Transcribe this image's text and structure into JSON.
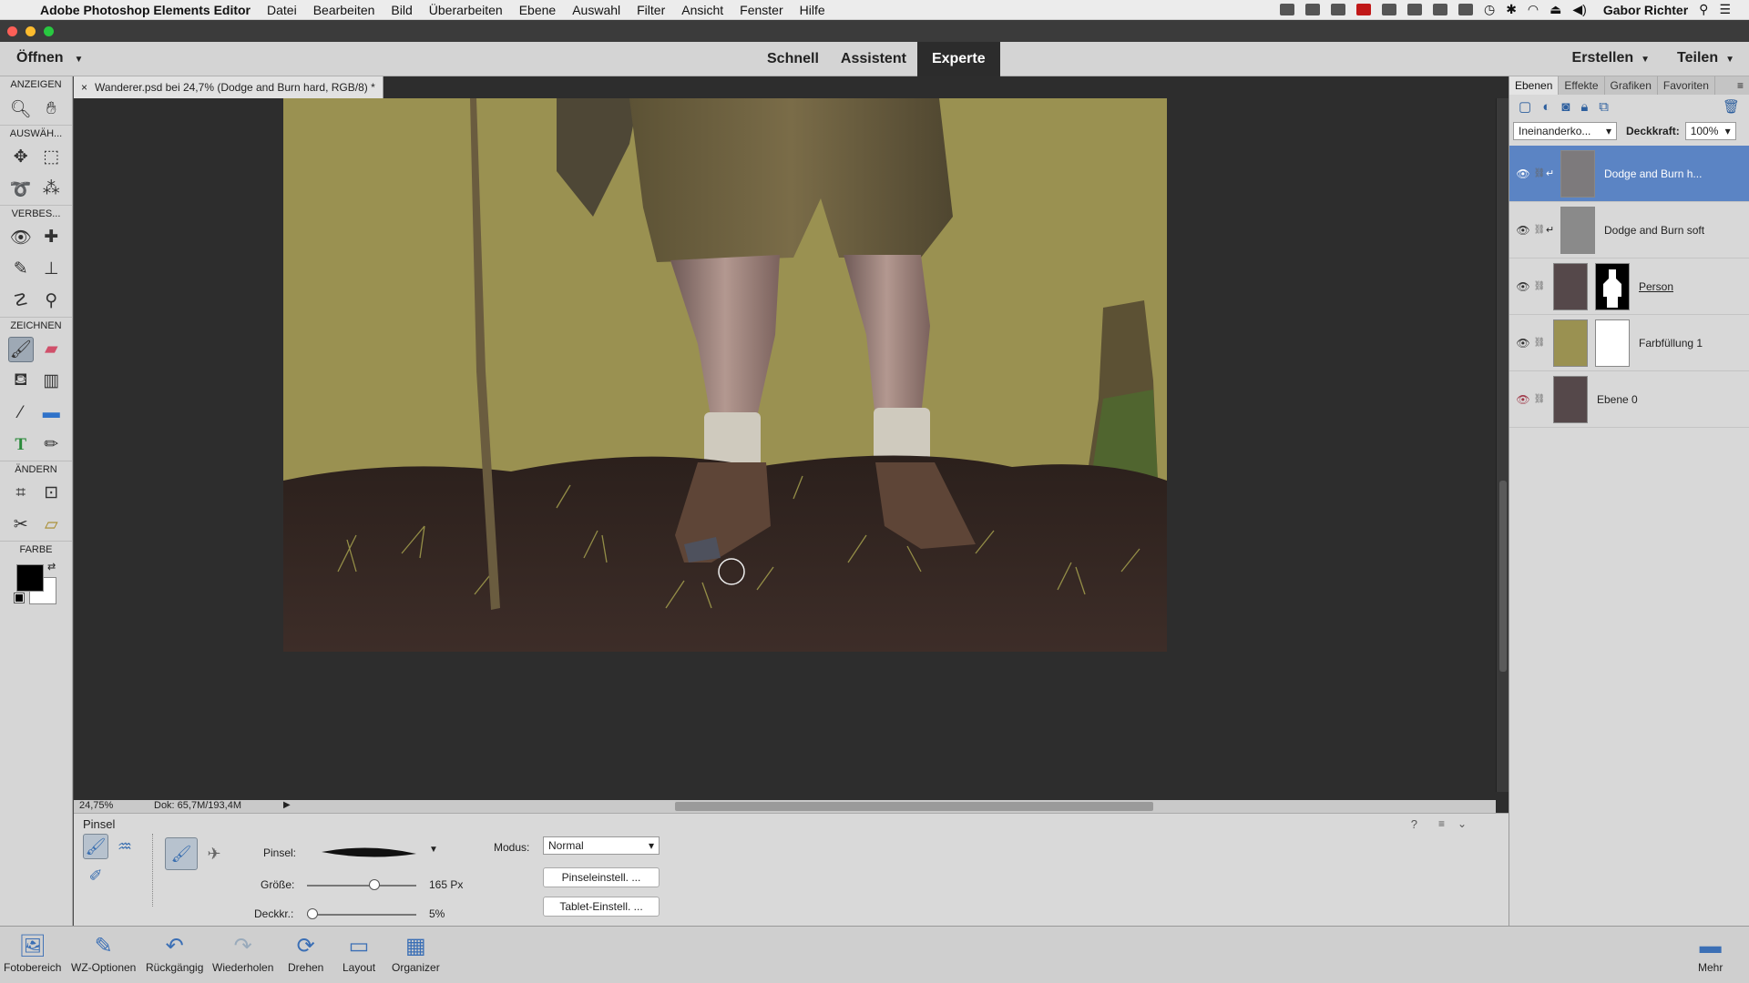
{
  "menubar": {
    "app_name": "Adobe Photoshop Elements Editor",
    "items": [
      "Datei",
      "Bearbeiten",
      "Bild",
      "Überarbeiten",
      "Ebene",
      "Auswahl",
      "Filter",
      "Ansicht",
      "Fenster",
      "Hilfe"
    ],
    "user": "Gabor Richter"
  },
  "modebar": {
    "open_label": "Öffnen",
    "modes": [
      "Schnell",
      "Assistent",
      "Experte"
    ],
    "active_mode": "Experte",
    "create_label": "Erstellen",
    "share_label": "Teilen"
  },
  "toolbox": {
    "sections": [
      "ANZEIGEN",
      "AUSWÄH...",
      "VERBES...",
      "ZEICHNEN",
      "ÄNDERN",
      "FARBE"
    ]
  },
  "document": {
    "tab_title": "Wanderer.psd bei 24,7% (Dodge and Burn hard, RGB/8) *",
    "zoom": "24,75%",
    "doc_info": "Dok: 65,7M/193,4M"
  },
  "layers_panel": {
    "tabs": [
      "Ebenen",
      "Effekte",
      "Grafiken",
      "Favoriten"
    ],
    "active_tab": "Ebenen",
    "blend_mode": "Ineinanderko...",
    "opacity_label": "Deckkraft:",
    "opacity_value": "100%",
    "layers": [
      {
        "name": "Dodge and Burn h...",
        "visible": true,
        "selected": true
      },
      {
        "name": "Dodge and Burn soft",
        "visible": true,
        "selected": false
      },
      {
        "name": "Person",
        "visible": true,
        "selected": false
      },
      {
        "name": "Farbfüllung 1",
        "visible": true,
        "selected": false
      },
      {
        "name": "Ebene 0",
        "visible": false,
        "selected": false
      }
    ]
  },
  "tool_options": {
    "title": "Pinsel",
    "brush_label": "Pinsel:",
    "size_label": "Größe:",
    "size_value": "165 Px",
    "size_fraction": 0.62,
    "opacity_label": "Deckkr.:",
    "opacity_value": "5%",
    "opacity_fraction": 0.05,
    "mode_label": "Modus:",
    "mode_value": "Normal",
    "brush_settings_button": "Pinseleinstell. ...",
    "tablet_settings_button": "Tablet-Einstell. ..."
  },
  "taskbar": {
    "items": [
      "Fotobereich",
      "WZ-Optionen",
      "Rückgängig",
      "Wiederholen",
      "Drehen",
      "Layout",
      "Organizer"
    ],
    "more_label": "Mehr"
  },
  "colors": {
    "accent": "#5b84c4",
    "canvas_bg": "#2d2d2d",
    "backdrop": "#9a9151",
    "soil": "#3b2a24"
  }
}
